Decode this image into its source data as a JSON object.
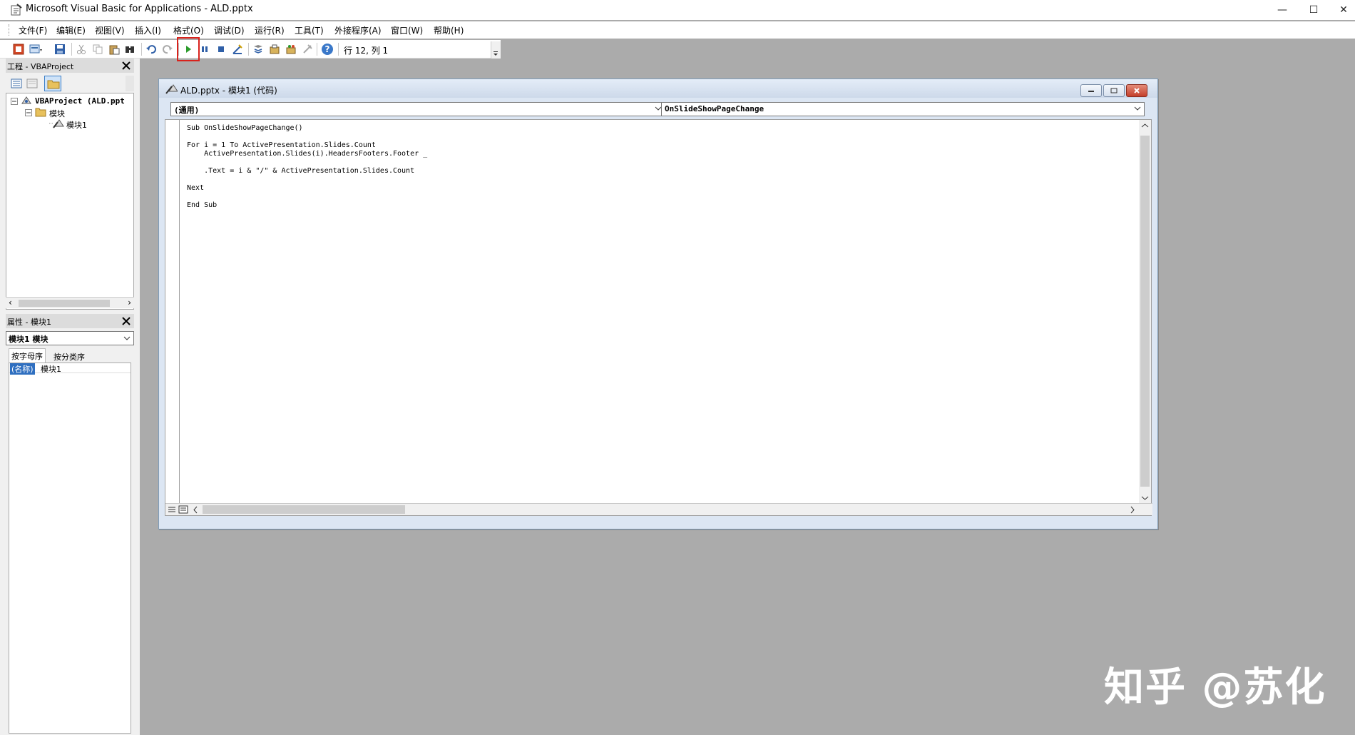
{
  "window": {
    "title": "Microsoft Visual Basic for Applications - ALD.pptx",
    "controls": [
      "—",
      "☐",
      "✕"
    ]
  },
  "menu": [
    "文件(F)",
    "编辑(E)",
    "视图(V)",
    "插入(I)",
    "格式(O)",
    "调试(D)",
    "运行(R)",
    "工具(T)",
    "外接程序(A)",
    "窗口(W)",
    "帮助(H)"
  ],
  "toolbar": {
    "position_text": "行 12, 列 1",
    "icons": [
      "view-powerpoint-icon",
      "insert-module-icon",
      "save-icon",
      "cut-icon",
      "copy-icon",
      "paste-icon",
      "find-icon",
      "undo-icon",
      "redo-icon",
      "run-icon",
      "break-icon",
      "reset-icon",
      "design-mode-icon",
      "project-explorer-icon",
      "properties-window-icon",
      "object-browser-icon",
      "toolbox-icon",
      "help-icon"
    ]
  },
  "project_pane": {
    "title": "工程 - VBAProject",
    "tree": [
      {
        "label": "VBAProject (ALD.ppt",
        "level": 0
      },
      {
        "label": "模块",
        "level": 1
      },
      {
        "label": "模块1",
        "level": 2
      }
    ]
  },
  "properties_pane": {
    "title": "属性 - 模块1",
    "object_select": "模块1 模块",
    "tabs": [
      "按字母序",
      "按分类序"
    ],
    "rows": [
      {
        "name": "(名称)",
        "value": "模块1"
      }
    ]
  },
  "code_window": {
    "title": "ALD.pptx - 模块1 (代码)",
    "object_dropdown": "(通用)",
    "procedure_dropdown": "OnSlideShowPageChange",
    "code_lines": [
      "Sub OnSlideShowPageChange()",
      "For i = 1 To ActivePresentation.Slides.Count",
      "    ActivePresentation.Slides(i).HeadersFooters.Footer _",
      "    .Text = i & \"/\" & ActivePresentation.Slides.Count",
      "Next",
      "End Sub"
    ]
  },
  "watermark": "知乎 @苏化"
}
